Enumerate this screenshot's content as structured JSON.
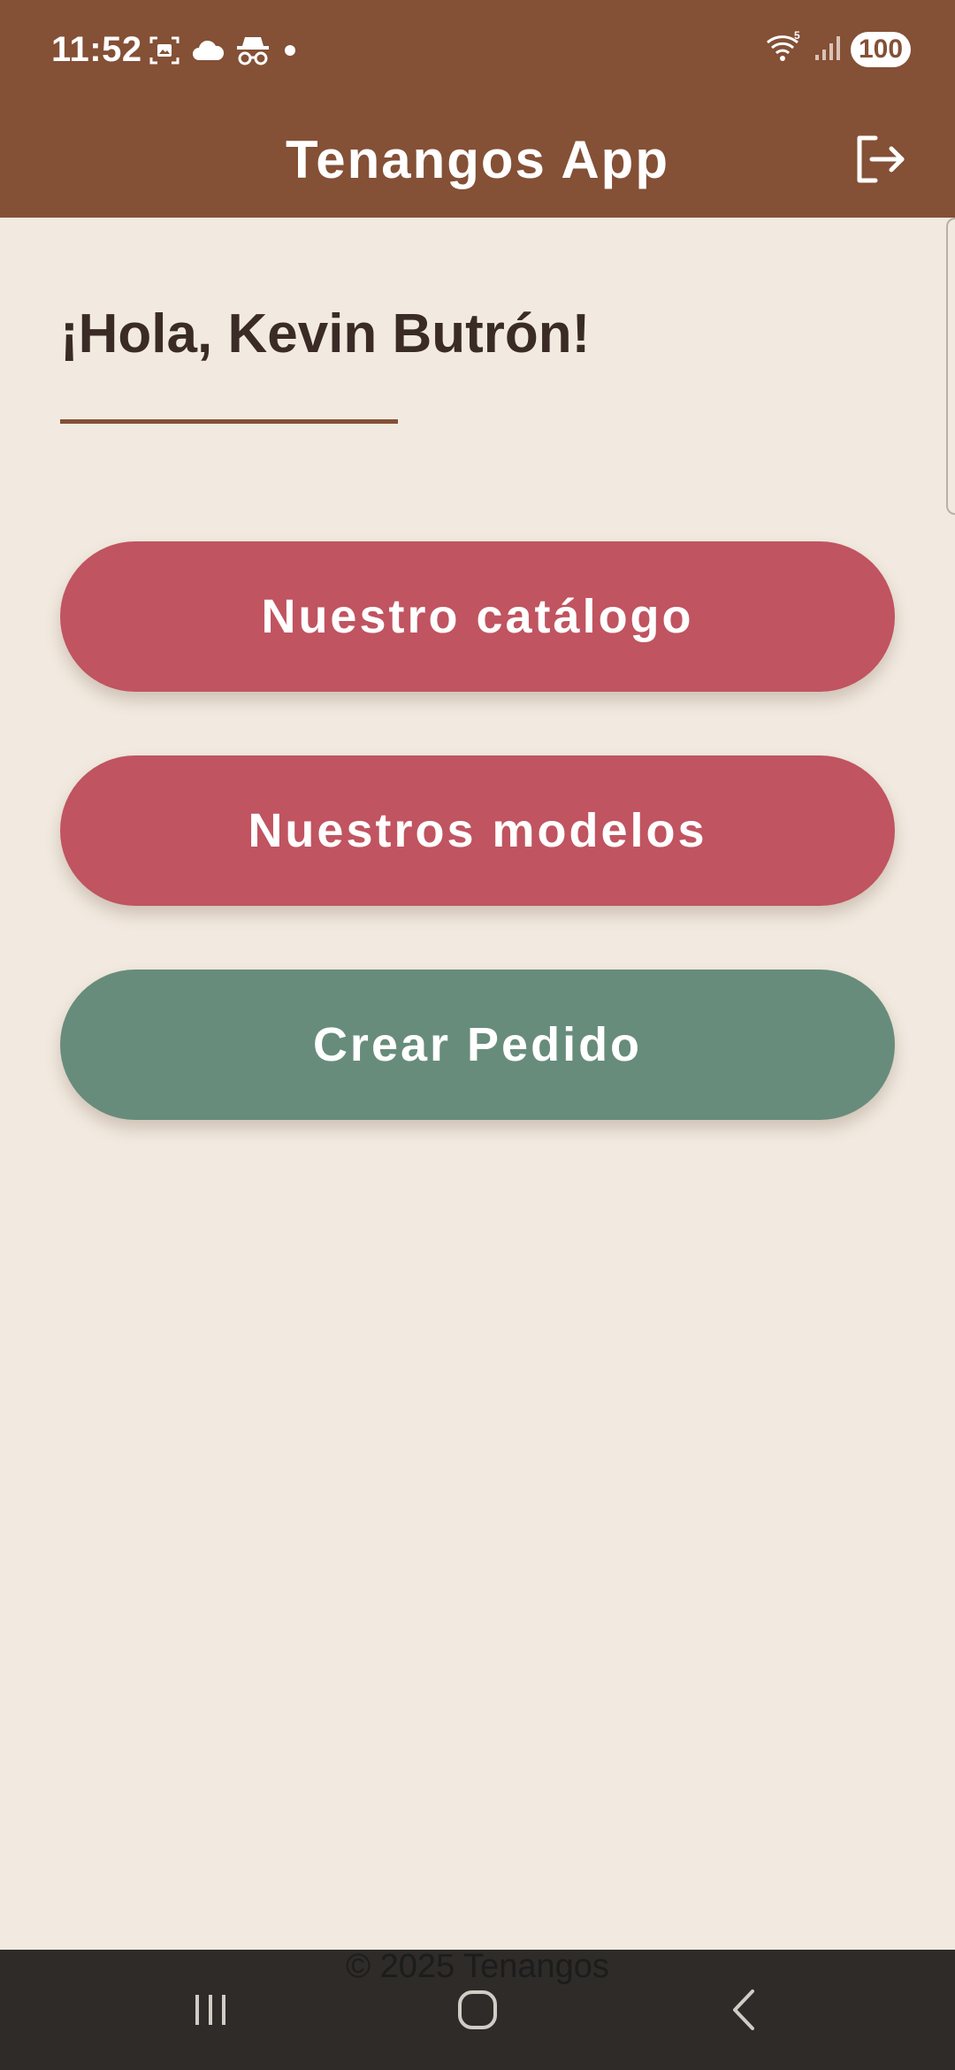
{
  "status_bar": {
    "time": "11:52",
    "battery": "100",
    "icons_left": [
      "screenshot-icon",
      "cloud-icon",
      "incognito-icon",
      "notification-dot-icon"
    ],
    "icons_right": [
      "wifi-icon",
      "signal-icon",
      "battery-icon"
    ]
  },
  "app_bar": {
    "title": "Tenangos App",
    "logout_icon": "logout-icon"
  },
  "main": {
    "greeting": "¡Hola, Kevin Butrón!",
    "buttons": [
      {
        "label": "Nuestro catálogo",
        "color": "#c05460"
      },
      {
        "label": "Nuestros modelos",
        "color": "#c05460"
      },
      {
        "label": "Crear Pedido",
        "color": "#678c7c"
      }
    ]
  },
  "footer": {
    "text": "© 2025 Tenangos"
  },
  "nav_bar": {
    "icons": [
      "recents-icon",
      "home-icon",
      "back-icon"
    ]
  },
  "colors": {
    "header": "#845036",
    "background": "#f2eae0",
    "primary_button": "#c05460",
    "secondary_button": "#678c7c",
    "nav_bar": "#2e2b28"
  }
}
